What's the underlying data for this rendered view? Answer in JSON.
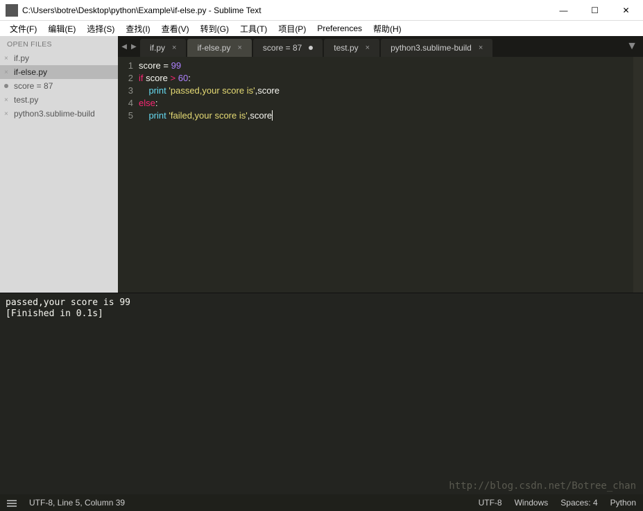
{
  "window": {
    "title": "C:\\Users\\botre\\Desktop\\python\\Example\\if-else.py - Sublime Text"
  },
  "menu": {
    "items": [
      "文件(F)",
      "编辑(E)",
      "选择(S)",
      "查找(I)",
      "查看(V)",
      "转到(G)",
      "工具(T)",
      "项目(P)",
      "Preferences",
      "帮助(H)"
    ]
  },
  "sidebar": {
    "header": "OPEN FILES",
    "files": [
      {
        "name": "if.py",
        "dirty": false,
        "active": false
      },
      {
        "name": "if-else.py",
        "dirty": false,
        "active": true
      },
      {
        "name": "score = 87",
        "dirty": true,
        "active": false
      },
      {
        "name": "test.py",
        "dirty": false,
        "active": false
      },
      {
        "name": "python3.sublime-build",
        "dirty": false,
        "active": false
      }
    ]
  },
  "tabs": {
    "items": [
      {
        "label": "if.py",
        "dirty": false,
        "active": false
      },
      {
        "label": "if-else.py",
        "dirty": false,
        "active": true
      },
      {
        "label": "score = 87",
        "dirty": true,
        "active": false
      },
      {
        "label": "test.py",
        "dirty": false,
        "active": false
      },
      {
        "label": "python3.sublime-build",
        "dirty": false,
        "active": false
      }
    ]
  },
  "editor": {
    "line_numbers": [
      "1",
      "2",
      "3",
      "4",
      "5"
    ],
    "tokens": {
      "l1_var": "score",
      "l1_eq": " = ",
      "l1_num": "99",
      "l2_if": "if",
      "l2_sp": " ",
      "l2_var": "score",
      "l2_op": " > ",
      "l2_num": "60",
      "l2_colon": ":",
      "l3_indent": "    ",
      "l3_print": "print",
      "l3_sp": " ",
      "l3_str": "'passed,your score is'",
      "l3_comma": ",",
      "l3_var": "score",
      "l4_else": "else",
      "l4_colon": ":",
      "l5_indent": "    ",
      "l5_print": "print",
      "l5_sp": " ",
      "l5_str": "'failed,your score is'",
      "l5_comma": ",",
      "l5_var": "score"
    }
  },
  "console": {
    "output": "passed,your score is 99\n[Finished in 0.1s]"
  },
  "statusbar": {
    "position": "UTF-8, Line 5, Column 39",
    "encoding": "UTF-8",
    "line_endings": "Windows",
    "indentation": "Spaces: 4",
    "syntax": "Python"
  },
  "watermark": "http://blog.csdn.net/Botree_chan"
}
